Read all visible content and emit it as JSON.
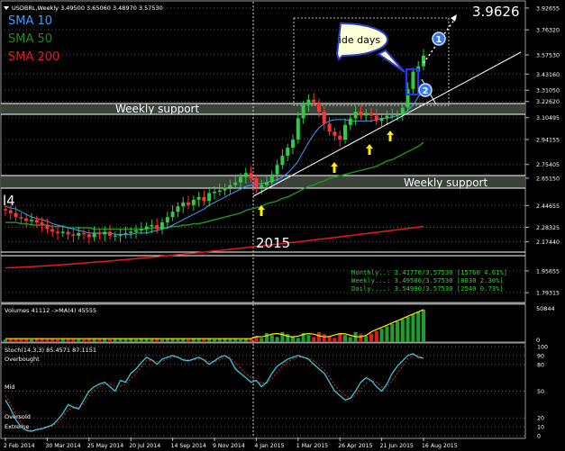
{
  "header": {
    "symbol_line": "USDBRL,Weekly  3.49500 3.65060 3.48970 3.57530",
    "sma_labels": [
      {
        "text": "SMA 10",
        "color": "#3aa0ff"
      },
      {
        "text": "SMA 50",
        "color": "#1f8f1f"
      },
      {
        "text": "SMA 200",
        "color": "#e21b1b"
      }
    ]
  },
  "annotations": {
    "big_price": "3.9626",
    "callout": "Two inside days",
    "weekly_support_top": "Weekly support",
    "weekly_support_bottom": "Weekly support",
    "year_label": "2015",
    "left_fragment": "l4",
    "marker_1": "1",
    "marker_2": "2"
  },
  "price_axis": {
    "ticks": [
      "3.92655",
      "3.76320",
      "3.57530",
      "3.43160",
      "3.31050",
      "3.22620",
      "3.10495",
      "2.94155",
      "2.75405",
      "2.65150",
      "2.44655",
      "2.28325",
      "2.17440",
      "1.95655",
      "1.79315"
    ]
  },
  "info_box": {
    "lines": [
      "Monthly..: 3.41770/3.57530 [15760 4.61%]",
      "Weekly...: 3.49500/3.57530 [8030 2.30%]",
      "Daily....: 3.54990/3.57530 [2540 0.73%]"
    ],
    "color": "#33cc33"
  },
  "volume_panel": {
    "label": "Volumes 41112  ->MA(4) 45555",
    "axis_ticks": [
      "50844",
      "0"
    ]
  },
  "stoch_panel": {
    "label": "Stoch(14,3,3) 85.4571 87.1151",
    "level_labels": [
      "Overbought",
      "Mid",
      "Oversold",
      "Extreme"
    ],
    "axis_ticks": [
      "100",
      "90",
      "80",
      "50",
      "20",
      "10",
      "0"
    ]
  },
  "time_axis": {
    "labels": [
      "2 Feb 2014",
      "30 Mar 2014",
      "25 May 2014",
      "20 Jul 2014",
      "14 Sep 2014",
      "9 Nov 2014",
      "4 Jan 2015",
      "1 Mar 2015",
      "26 Apr 2015",
      "21 Jun 2015",
      "16 Aug 2015"
    ]
  },
  "chart_data": {
    "type": "candlestick",
    "title": "USDBRL,Weekly",
    "x": [
      "2014-02-02",
      "2014-02-09",
      "2014-02-16",
      "2014-02-23",
      "2014-03-02",
      "2014-03-09",
      "2014-03-16",
      "2014-03-23",
      "2014-03-30",
      "2014-04-06",
      "2014-04-13",
      "2014-04-20",
      "2014-04-27",
      "2014-05-04",
      "2014-05-11",
      "2014-05-18",
      "2014-05-25",
      "2014-06-01",
      "2014-06-08",
      "2014-06-15",
      "2014-06-22",
      "2014-06-29",
      "2014-07-06",
      "2014-07-13",
      "2014-07-20",
      "2014-07-27",
      "2014-08-03",
      "2014-08-10",
      "2014-08-17",
      "2014-08-24",
      "2014-08-31",
      "2014-09-07",
      "2014-09-14",
      "2014-09-21",
      "2014-09-28",
      "2014-10-05",
      "2014-10-12",
      "2014-10-19",
      "2014-10-26",
      "2014-11-02",
      "2014-11-09",
      "2014-11-16",
      "2014-11-23",
      "2014-11-30",
      "2014-12-07",
      "2014-12-14",
      "2014-12-21",
      "2014-12-28",
      "2015-01-04",
      "2015-01-11",
      "2015-01-18",
      "2015-01-25",
      "2015-02-01",
      "2015-02-08",
      "2015-02-15",
      "2015-02-22",
      "2015-03-01",
      "2015-03-08",
      "2015-03-15",
      "2015-03-22",
      "2015-03-29",
      "2015-04-05",
      "2015-04-12",
      "2015-04-19",
      "2015-04-26",
      "2015-05-03",
      "2015-05-10",
      "2015-05-17",
      "2015-05-24",
      "2015-05-31",
      "2015-06-07",
      "2015-06-14",
      "2015-06-21",
      "2015-06-28",
      "2015-07-05",
      "2015-07-12",
      "2015-07-19",
      "2015-07-26",
      "2015-08-02",
      "2015-08-09",
      "2015-08-16"
    ],
    "close": [
      2.41,
      2.39,
      2.36,
      2.35,
      2.33,
      2.34,
      2.32,
      2.3,
      2.27,
      2.25,
      2.24,
      2.25,
      2.23,
      2.22,
      2.24,
      2.23,
      2.21,
      2.24,
      2.23,
      2.25,
      2.22,
      2.22,
      2.23,
      2.24,
      2.25,
      2.26,
      2.27,
      2.29,
      2.3,
      2.27,
      2.32,
      2.36,
      2.4,
      2.44,
      2.47,
      2.45,
      2.49,
      2.51,
      2.48,
      2.54,
      2.55,
      2.56,
      2.58,
      2.6,
      2.62,
      2.66,
      2.69,
      2.65,
      2.58,
      2.6,
      2.62,
      2.68,
      2.75,
      2.82,
      2.88,
      2.94,
      3.1,
      3.2,
      3.24,
      3.22,
      3.15,
      3.06,
      3.0,
      2.97,
      2.94,
      3.05,
      3.1,
      3.15,
      3.12,
      3.14,
      3.12,
      3.08,
      3.1,
      3.12,
      3.12,
      3.13,
      3.18,
      3.32,
      3.45,
      3.49,
      3.57
    ],
    "sma10": [
      2.44,
      2.43,
      2.42,
      2.4,
      2.38,
      2.36,
      2.35,
      2.34,
      2.33,
      2.31,
      2.3,
      2.29,
      2.28,
      2.27,
      2.26,
      2.25,
      2.24,
      2.24,
      2.24,
      2.24,
      2.24,
      2.23,
      2.23,
      2.23,
      2.23,
      2.24,
      2.24,
      2.24,
      2.25,
      2.26,
      2.27,
      2.28,
      2.3,
      2.32,
      2.34,
      2.36,
      2.38,
      2.4,
      2.42,
      2.45,
      2.47,
      2.49,
      2.51,
      2.53,
      2.55,
      2.57,
      2.59,
      2.6,
      2.61,
      2.61,
      2.62,
      2.63,
      2.64,
      2.66,
      2.69,
      2.73,
      2.78,
      2.85,
      2.92,
      2.98,
      3.03,
      3.06,
      3.08,
      3.09,
      3.09,
      3.09,
      3.08,
      3.08,
      3.08,
      3.08,
      3.08,
      3.09,
      3.1,
      3.1,
      3.11,
      3.12,
      3.13,
      3.16,
      3.2,
      3.26,
      3.32
    ],
    "sma50": [
      2.32,
      2.32,
      2.32,
      2.31,
      2.31,
      2.3,
      2.3,
      2.3,
      2.3,
      2.29,
      2.29,
      2.29,
      2.28,
      2.28,
      2.28,
      2.28,
      2.28,
      2.27,
      2.27,
      2.27,
      2.27,
      2.27,
      2.27,
      2.27,
      2.27,
      2.27,
      2.27,
      2.27,
      2.28,
      2.28,
      2.28,
      2.28,
      2.29,
      2.29,
      2.3,
      2.3,
      2.31,
      2.31,
      2.32,
      2.33,
      2.34,
      2.35,
      2.36,
      2.37,
      2.38,
      2.39,
      2.41,
      2.42,
      2.43,
      2.44,
      2.46,
      2.47,
      2.48,
      2.5,
      2.51,
      2.53,
      2.55,
      2.57,
      2.59,
      2.6,
      2.62,
      2.63,
      2.65,
      2.66,
      2.67,
      2.68,
      2.69,
      2.7,
      2.71,
      2.72,
      2.73,
      2.74,
      2.76,
      2.78,
      2.79,
      2.81,
      2.83,
      2.85,
      2.87,
      2.89,
      2.92
    ],
    "sma200_endpoints": [
      1.98,
      2.29
    ],
    "volume_max": 50844,
    "stoch_main": [
      40,
      30,
      18,
      10,
      6,
      5,
      7,
      8,
      10,
      12,
      18,
      25,
      35,
      32,
      30,
      40,
      50,
      55,
      58,
      60,
      55,
      50,
      62,
      60,
      70,
      75,
      82,
      88,
      85,
      80,
      86,
      88,
      90,
      88,
      85,
      84,
      86,
      88,
      85,
      80,
      84,
      88,
      90,
      86,
      75,
      70,
      65,
      60,
      62,
      55,
      60,
      70,
      78,
      82,
      86,
      88,
      90,
      88,
      86,
      80,
      75,
      70,
      60,
      50,
      45,
      40,
      42,
      50,
      60,
      65,
      62,
      55,
      50,
      58,
      70,
      78,
      84,
      90,
      92,
      88,
      87
    ],
    "stoch_signal": [
      45,
      35,
      24,
      14,
      8,
      6,
      6,
      7,
      9,
      11,
      15,
      21,
      29,
      31,
      32,
      36,
      44,
      51,
      55,
      58,
      58,
      55,
      56,
      58,
      64,
      70,
      77,
      84,
      85,
      83,
      84,
      86,
      88,
      88,
      86,
      85,
      85,
      86,
      86,
      83,
      83,
      85,
      88,
      88,
      82,
      76,
      70,
      65,
      62,
      59,
      59,
      64,
      72,
      78,
      83,
      86,
      88,
      88,
      87,
      84,
      79,
      74,
      66,
      57,
      50,
      45,
      42,
      45,
      52,
      59,
      62,
      60,
      55,
      55,
      62,
      70,
      78,
      86,
      90,
      90,
      87
    ],
    "price_ylim": [
      1.72,
      3.98
    ],
    "stoch_levels": [
      100,
      90,
      80,
      50,
      20,
      10,
      0
    ]
  }
}
